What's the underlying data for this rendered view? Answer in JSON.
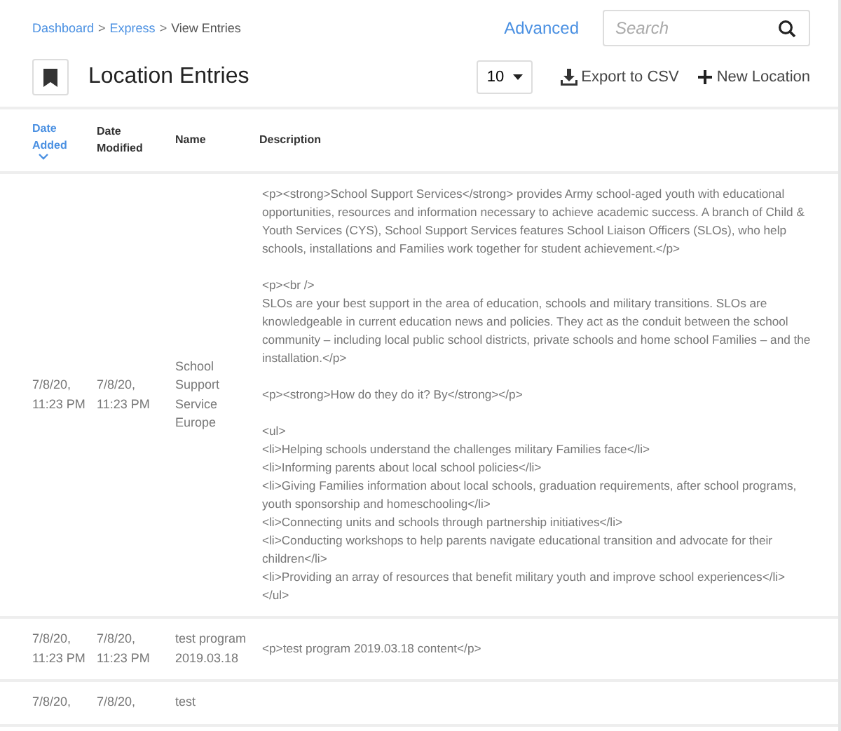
{
  "breadcrumb_separator": ">",
  "breadcrumb": [
    {
      "label": "Dashboard",
      "link": true
    },
    {
      "label": "Express",
      "link": true
    },
    {
      "label": "View Entries",
      "link": false
    }
  ],
  "advanced_link": "Advanced",
  "search": {
    "placeholder": "Search"
  },
  "title": "Location Entries",
  "page_size": "10",
  "export_button": "Export to CSV",
  "new_button": "New Location",
  "table": {
    "columns": [
      {
        "label": "Date Added",
        "sorted": true
      },
      {
        "label": "Date Modified",
        "sorted": false
      },
      {
        "label": "Name",
        "sorted": false
      },
      {
        "label": "Description",
        "sorted": false
      }
    ],
    "rows": [
      {
        "date_added": "7/8/20, 11:23 PM",
        "date_modified": "7/8/20, 11:23 PM",
        "name": "School Support Service Europe",
        "description": "<p><strong>School Support Services</strong> provides Army school-aged youth with educational opportunities, resources and information necessary to achieve academic success. A branch of Child & Youth Services (CYS), School Support Services features School Liaison Officers (SLOs), who help schools, installations and Families work together for student achievement.</p>\n\n<p><br />\nSLOs are your best support in the area of education, schools and military transitions. SLOs are knowledgeable in current education news and policies. They act as the conduit between the school community – including local public school districts, private schools and home school Families – and the installation.</p>\n\n<p><strong>How do they do it? By</strong></p>\n\n<ul>\n<li>Helping schools understand the challenges military Families face</li>\n<li>Informing parents about local school policies</li>\n<li>Giving Families information about local schools, graduation requirements, after school programs, youth sponsorship and homeschooling</li>\n<li>Connecting units and schools through partnership initiatives</li>\n<li>Conducting workshops to help parents navigate educational transition and advocate for their children</li>\n<li>Providing an array of resources that benefit military youth and improve school experiences</li>\n</ul>"
      },
      {
        "date_added": "7/8/20, 11:23 PM",
        "date_modified": "7/8/20, 11:23 PM",
        "name": "test program 2019.03.18",
        "description": "<p>test program 2019.03.18 content</p>"
      },
      {
        "date_added": "7/8/20,",
        "date_modified": "7/8/20,",
        "name": "test",
        "description": ""
      }
    ]
  }
}
